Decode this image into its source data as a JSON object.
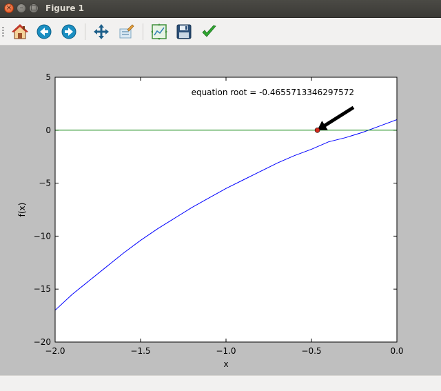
{
  "window": {
    "title": "Figure 1",
    "close_glyph": "×",
    "minimize_glyph": "–",
    "maximize_glyph": "□"
  },
  "toolbar": {
    "buttons": [
      {
        "name": "home",
        "icon": "home-icon"
      },
      {
        "name": "back",
        "icon": "back-arrow-icon"
      },
      {
        "name": "forward",
        "icon": "forward-arrow-icon"
      },
      {
        "name": "pan",
        "icon": "pan-icon"
      },
      {
        "name": "zoom",
        "icon": "zoom-rect-icon"
      },
      {
        "name": "subplots",
        "icon": "subplots-icon"
      },
      {
        "name": "save",
        "icon": "floppy-save-icon"
      },
      {
        "name": "edit",
        "icon": "checkmark-icon"
      }
    ]
  },
  "chart_data": {
    "type": "line",
    "xlabel": "x",
    "ylabel": "f(x)",
    "xlim": [
      -2.0,
      0.0
    ],
    "ylim": [
      -20,
      5
    ],
    "xticks": [
      -2.0,
      -1.5,
      -1.0,
      -0.5,
      0.0
    ],
    "xtick_labels": [
      "−2.0",
      "−1.5",
      "−1.0",
      "−0.5",
      "0.0"
    ],
    "yticks": [
      5,
      0,
      -5,
      -10,
      -15,
      -20
    ],
    "ytick_labels": [
      "5",
      "0",
      "−5",
      "−10",
      "−15",
      "−20"
    ],
    "series": [
      {
        "color": "#0000ff",
        "x": [
          -2.0,
          -1.9,
          -1.8,
          -1.7,
          -1.6,
          -1.5,
          -1.4,
          -1.3,
          -1.2,
          -1.1,
          -1.0,
          -0.9,
          -0.8,
          -0.7,
          -0.6,
          -0.5,
          -0.4,
          -0.3,
          -0.2,
          -0.1,
          0.0
        ],
        "y": [
          -17.0,
          -15.5,
          -14.2,
          -12.9,
          -11.6,
          -10.4,
          -9.3,
          -8.3,
          -7.3,
          -6.4,
          -5.5,
          -4.7,
          -3.9,
          -3.1,
          -2.4,
          -1.8,
          -1.1,
          -0.7,
          -0.2,
          0.4,
          1.0
        ]
      },
      {
        "color": "#008000",
        "x": [
          -2.0,
          0.0
        ],
        "y": [
          0,
          0
        ]
      }
    ],
    "root_point": {
      "x": -0.4655713346297572,
      "y": 0,
      "color": "#d42a1c"
    },
    "annotation": {
      "text": "equation root = -0.4655713346297572",
      "x": -0.25,
      "y": 2.8,
      "arrow_color": "#000000"
    },
    "grid": false
  }
}
